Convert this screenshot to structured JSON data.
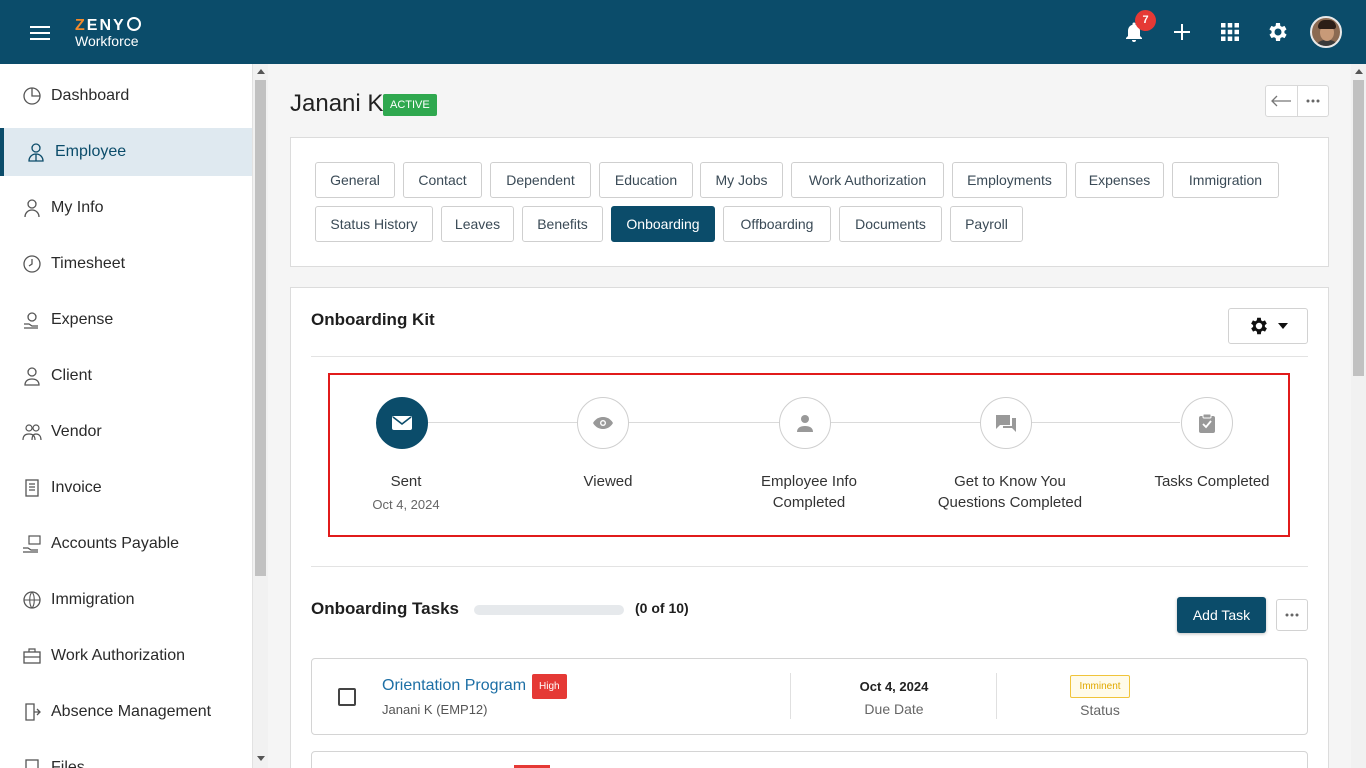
{
  "app": {
    "logo_top": "ZENY",
    "logo_bottom": "Workforce",
    "notification_count": "7",
    "accent_color": "#0b4c6a"
  },
  "sidebar": {
    "items": [
      {
        "label": "Dashboard",
        "icon": "dashboard-icon"
      },
      {
        "label": "Employee",
        "icon": "employee-icon",
        "active": true
      },
      {
        "label": "My Info",
        "icon": "my-info-icon"
      },
      {
        "label": "Timesheet",
        "icon": "clock-icon"
      },
      {
        "label": "Expense",
        "icon": "expense-icon"
      },
      {
        "label": "Client",
        "icon": "client-icon"
      },
      {
        "label": "Vendor",
        "icon": "vendor-icon"
      },
      {
        "label": "Invoice",
        "icon": "invoice-icon"
      },
      {
        "label": "Accounts Payable",
        "icon": "accounts-payable-icon"
      },
      {
        "label": "Immigration",
        "icon": "globe-icon"
      },
      {
        "label": "Work Authorization",
        "icon": "briefcase-icon"
      },
      {
        "label": "Absence Management",
        "icon": "exit-icon"
      },
      {
        "label": "Files",
        "icon": "files-icon"
      }
    ]
  },
  "employee": {
    "name": "Janani K",
    "status": "ACTIVE"
  },
  "tabs": [
    "General",
    "Contact",
    "Dependent",
    "Education",
    "My Jobs",
    "Work Authorization",
    "Employments",
    "Expenses",
    "Immigration",
    "Status History",
    "Leaves",
    "Benefits",
    "Onboarding",
    "Offboarding",
    "Documents",
    "Payroll"
  ],
  "selected_tab": "Onboarding",
  "onboarding_kit": {
    "title": "Onboarding Kit",
    "steps": [
      {
        "label": "Sent",
        "date": "Oct 4, 2024",
        "icon": "mail-icon",
        "done": true
      },
      {
        "label": "Viewed",
        "date": "",
        "icon": "eye-icon",
        "done": false
      },
      {
        "label": "Employee Info Completed",
        "date": "",
        "icon": "person-icon",
        "done": false
      },
      {
        "label": "Get to Know You Questions Completed",
        "date": "",
        "icon": "chat-icon",
        "done": false
      },
      {
        "label": "Tasks Completed",
        "date": "",
        "icon": "clipboard-check-icon",
        "done": false
      }
    ]
  },
  "onboarding_tasks": {
    "title": "Onboarding Tasks",
    "progress_text": "(0 of 10)",
    "progress_fraction": 0,
    "add_task_label": "Add Task",
    "tasks": [
      {
        "name": "Orientation Program",
        "priority": "High",
        "assignee": "Janani K (EMP12)",
        "due_date": "Oct 4, 2024",
        "due_label": "Due Date",
        "status": "Imminent",
        "status_label": "Status"
      }
    ]
  }
}
